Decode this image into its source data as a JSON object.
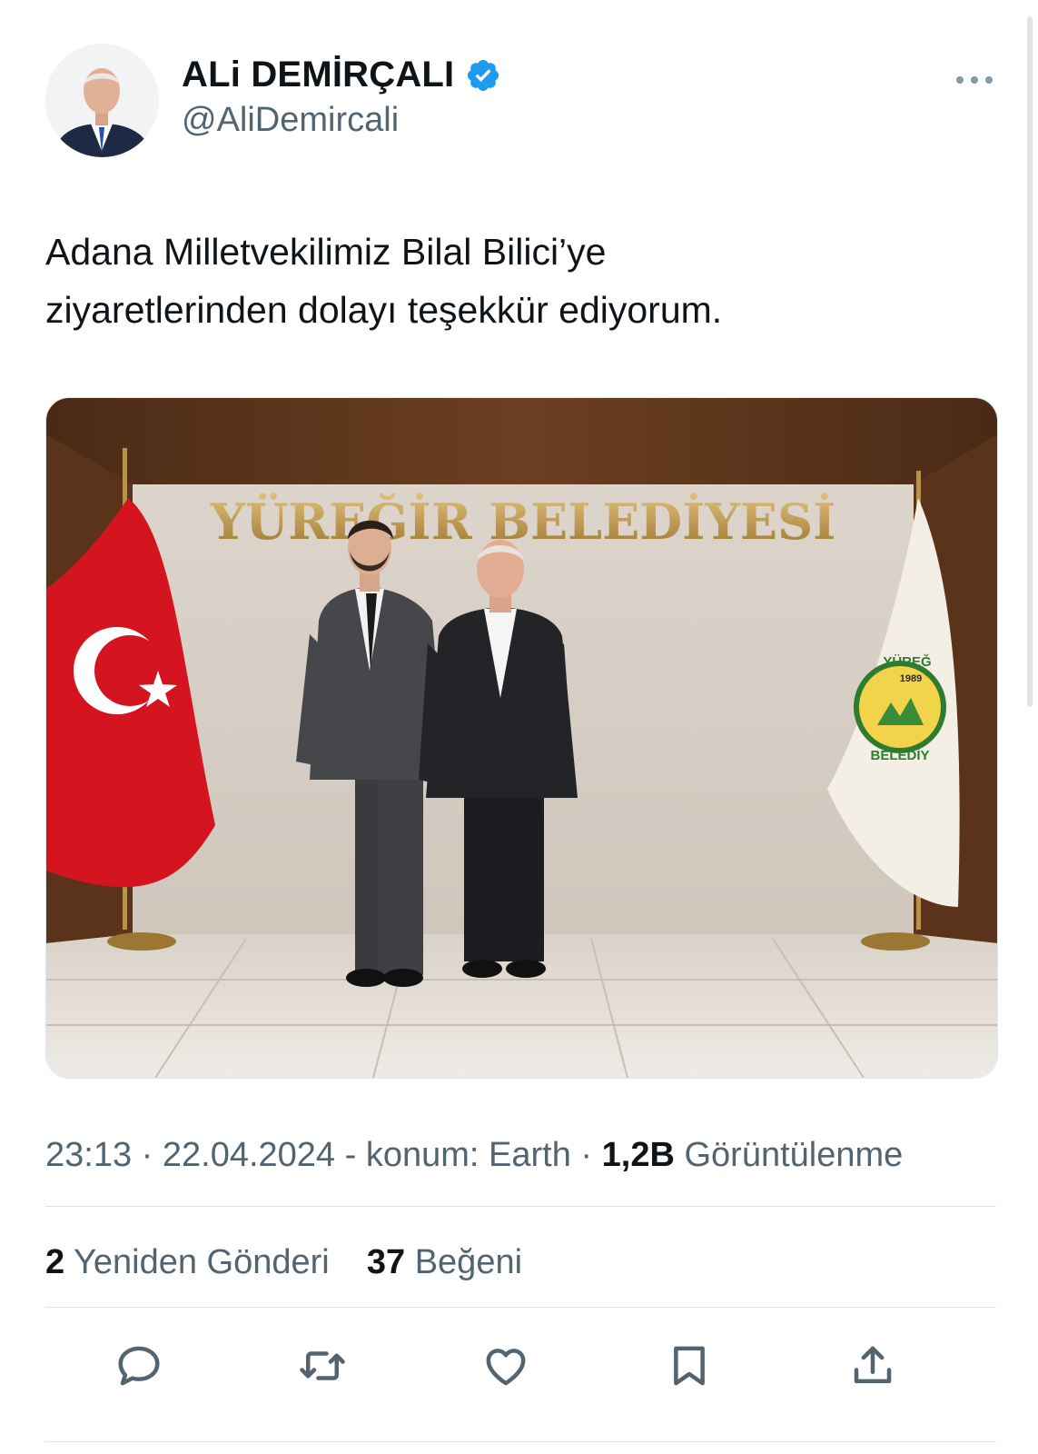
{
  "author": {
    "display_name": "ALi DEMİRÇALI",
    "handle": "@AliDemircali",
    "verified": true
  },
  "tweet": {
    "text_line1": "Adana Milletvekilimiz Bilal Bilici’ye",
    "text_line2": "ziyaretlerinden dolayı teşekkür ediyorum."
  },
  "media": {
    "sign_text": "YÜREĞİR BELEDİYESİ",
    "emblem_year": "1989",
    "emblem_top": "YÜREĞ",
    "emblem_bottom": "BELEDİY"
  },
  "meta": {
    "time": "23:13",
    "date": "22.04.2024",
    "location": "konum: Earth",
    "views_count": "1,2B",
    "views_label": "Görüntülenme"
  },
  "stats": {
    "reposts_count": "2",
    "reposts_label": "Yeniden Gönderi",
    "likes_count": "37",
    "likes_label": "Beğeni"
  },
  "icons": [
    "reply-icon",
    "repost-icon",
    "like-icon",
    "bookmark-icon",
    "share-icon",
    "more-icon",
    "verified-badge-icon"
  ],
  "colors": {
    "text": "#0f1419",
    "secondary": "#536471",
    "verified": "#1d9bf0",
    "divider": "#dfe3e6"
  }
}
